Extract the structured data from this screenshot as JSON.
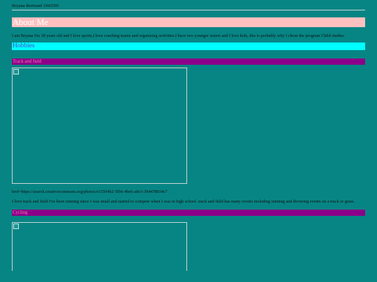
{
  "header": {
    "name": "Bryana Bertrand 1943595"
  },
  "about": {
    "heading": "About Me",
    "text": "I am Bryana I'm 18 years old and I love sports,I love coaching teams and organizing activities.I have two younger sisters and I love kids, this is probably why I chose the program Child studies."
  },
  "hobbies": {
    "heading": "Hobbies",
    "items": [
      {
        "title": "Track and field",
        "image_link": "href=https://search.creativecommons.org/photos/e15504b2-5fb6-4be6-a0e3-394478834c7",
        "description": "I love track and field I've been running since I was small and started to compete when I was in high school. track and field has many events including running and throwing events on a track or grass."
      },
      {
        "title": "Cycling"
      }
    ]
  },
  "colors": {
    "background": "#078584",
    "about_heading_bg": "#ffc0c0",
    "hobbies_heading_bg": "#00ffff",
    "sub_heading_bg": "#8b0089"
  }
}
